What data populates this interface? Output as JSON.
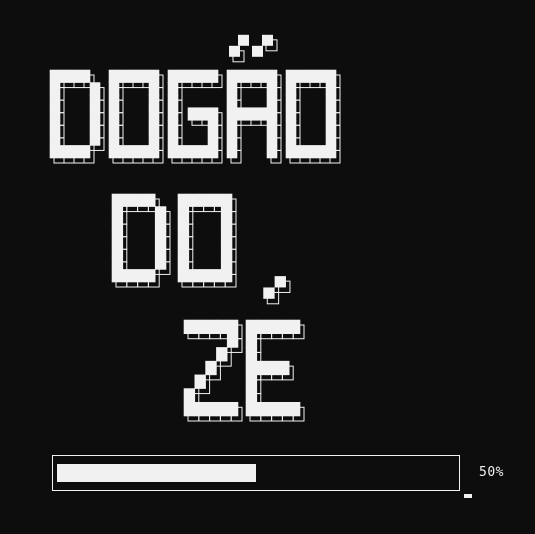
{
  "title": {
    "line1": "DOGÃO",
    "line2": "DO",
    "line3": "ZÉ"
  },
  "loading": {
    "progress": 0.5,
    "percent_label": "50%"
  },
  "colors": {
    "background": "#0d0d0e",
    "foreground": "#f1f1f1"
  }
}
